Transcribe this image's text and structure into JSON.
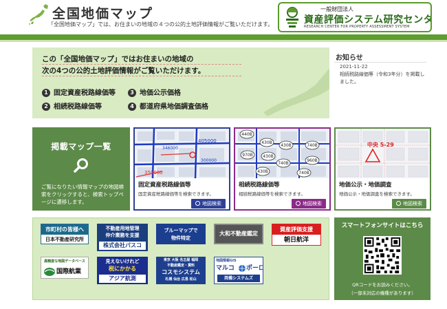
{
  "header": {
    "title": "全国地価マップ",
    "subtitle": "「全国地価マップ」では、お住まいの地域の４つの公的土地評価情報がご覧いただけます。",
    "org_prefix": "一般財団法人",
    "org_name": "資産評価システム研究センター",
    "org_english": "RESEARCH CENTER FOR PROPERTY ASSESSMENT SYSTEM"
  },
  "banner": {
    "line1": "この「全国地価マップ」ではお住まいの地域の",
    "line2": "次の4つの公的土地評価情報がご覧いただけます。",
    "items": [
      {
        "num": "1",
        "label": "固定資産税路線価等"
      },
      {
        "num": "2",
        "label": "相続税路線価等"
      },
      {
        "num": "3",
        "label": "地価公示価格"
      },
      {
        "num": "4",
        "label": "都道府県地価調査価格"
      }
    ]
  },
  "news": {
    "title": "お知らせ",
    "date": "2021-11-22",
    "body": "相続税路線価等（令和3年分）を掲載しました。"
  },
  "map_list": {
    "title": "掲載マップ一覧",
    "description": "ご覧になりたい情報マップの地図検索をクリックすると、検索トップページに遷移します。"
  },
  "map_cards": [
    {
      "title": "固定資産税路線価等",
      "description": "固定資産税路線価等を検索できます。",
      "button": "地図検索",
      "color": "#2d3f96"
    },
    {
      "title": "相続税路線価等",
      "description": "相続税路線価等を検索できます。",
      "button": "地図検索",
      "color": "#8b2a88"
    },
    {
      "title": "地価公示・地価調査",
      "description": "地価公示・地価調査を検索できます。",
      "button": "地図検索",
      "color": "#5c8a48"
    }
  ],
  "thumb_labels": {
    "card1": [
      "405000",
      "359000",
      "346000",
      "300000"
    ],
    "card2": [
      "440B",
      "430B",
      "430B",
      "740B",
      "970B",
      "430B",
      "740B",
      "960B",
      "430B",
      "740B"
    ],
    "card3": [
      "中央 5-29"
    ]
  },
  "ads": {
    "shichoson": {
      "line1": "市町村の皆様へ",
      "line2": "日本不動産研究所"
    },
    "pasco": {
      "line1": "不動産用地管理",
      "line2": "仲介業務を支援",
      "line3": "株式会社パスコ"
    },
    "bluemap": {
      "line1": "ブルーマップで",
      "line2": "物件特定"
    },
    "daiwa": {
      "line1": "大和不動産鑑定"
    },
    "asahi": {
      "line1": "資産評価支援",
      "line2": "朝日航洋"
    },
    "kokusai": {
      "line1": "高精度な地図データベース",
      "line2": "国際航業"
    },
    "asia": {
      "line1": "見えないけれど",
      "line2": "税にかかる",
      "line3": "アジア航測"
    },
    "cosmo": {
      "line1": "東京 大阪 名古屋 福岡",
      "line2": "不動産鑑定・賃料",
      "line3": "コスモシステム",
      "line4": "札幌 仙台 広島 松山"
    },
    "marco": {
      "line1": "地図情報GIS",
      "line2": "マルコ",
      "line3": "ポーロ",
      "line4": "両備システムズ"
    }
  },
  "smartphone": {
    "title": "スマートフォンサイトはこちら",
    "text1": "QRコードをお読みください。",
    "text2": "（一部未対応の機種があります）"
  },
  "colors": {
    "brand_green": "#5e9d2f",
    "card_green": "#5c8a48",
    "banner_bg": "#d9ebc2",
    "card_blue": "#2d3f96",
    "card_purple": "#8b2a88"
  }
}
